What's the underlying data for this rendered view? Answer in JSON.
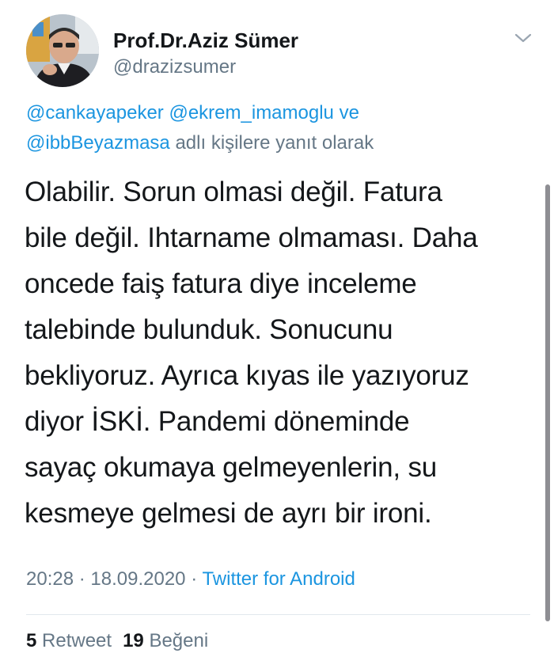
{
  "author": {
    "display_name": "Prof.Dr.Aziz Sümer",
    "handle": "@drazizsumer"
  },
  "reply_context": {
    "mention_1": "@cankayapeker",
    "mention_2": "@ekrem_imamoglu",
    "connector": "ve",
    "mention_3": "@ibbBeyazmasa",
    "suffix": "adlı kişilere yanıt olarak"
  },
  "tweet": {
    "lines": [
      "Olabilir. Sorun olmasi değil. Fatura",
      "bile değil. Ihtarname olmaması. Daha",
      "oncede faiş fatura diye inceleme",
      "talebinde bulunduk. Sonucunu",
      "bekliyoruz. Ayrıca kıyas ile yazıyoruz",
      "diyor İSKİ. Pandemi döneminde",
      "sayaç okumaya gelmeyenlerin, su",
      "kesmeye gelmesi de ayrı bir ironi."
    ]
  },
  "meta": {
    "time": "20:28",
    "separator": "·",
    "date": "18.09.2020",
    "source": "Twitter for Android"
  },
  "stats": {
    "retweet_count": "5",
    "retweet_label": "Retweet",
    "like_count": "19",
    "like_label": "Beğeni"
  },
  "icons": {
    "menu": "chevron-down-icon"
  },
  "colors": {
    "link": "#1b95e0",
    "secondary_text": "#657786",
    "primary_text": "#14171a"
  }
}
